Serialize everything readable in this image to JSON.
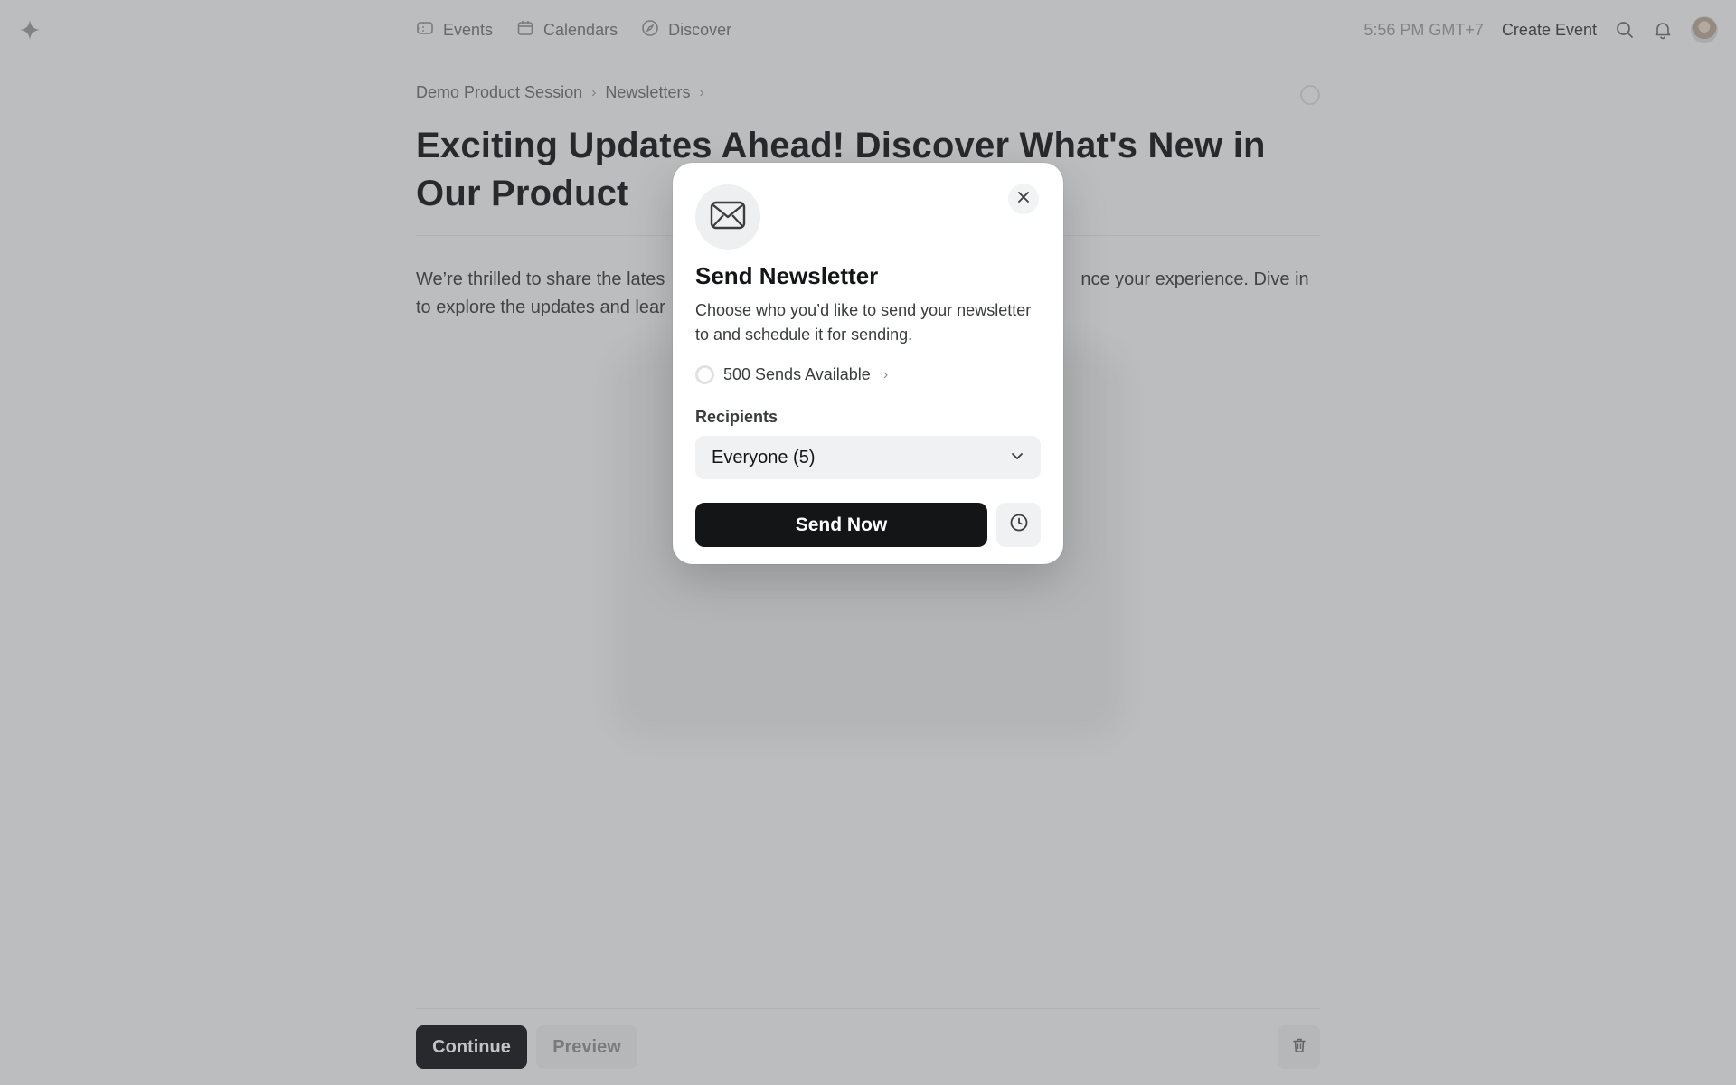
{
  "nav": {
    "logo_icon": "sparkle-icon",
    "links": [
      {
        "label": "Events",
        "icon": "ticket-icon"
      },
      {
        "label": "Calendars",
        "icon": "calendar-icon"
      },
      {
        "label": "Discover",
        "icon": "compass-icon"
      }
    ],
    "clock": "5:56 PM GMT+7",
    "create_event": "Create Event"
  },
  "breadcrumb": {
    "items": [
      "Demo Product Session",
      "Newsletters"
    ],
    "separator": "›"
  },
  "page": {
    "title": "Exciting Updates Ahead! Discover What's New in Our Product",
    "body_start": "We’re thrilled to share the lates",
    "body_end": "nce your experience. Dive in",
    "body_line2": "to explore the updates and lear"
  },
  "footer": {
    "continue_label": "Continue",
    "preview_label": "Preview"
  },
  "modal": {
    "icon": "envelope-icon",
    "title": "Send Newsletter",
    "description": "Choose who you’d like to send your newsletter to and schedule it for sending.",
    "sends_available": "500 Sends Available",
    "recipients_label": "Recipients",
    "recipients_value": "Everyone (5)",
    "send_now_label": "Send Now"
  },
  "colors": {
    "primary_button": "#131517",
    "overlay": "#505255"
  }
}
